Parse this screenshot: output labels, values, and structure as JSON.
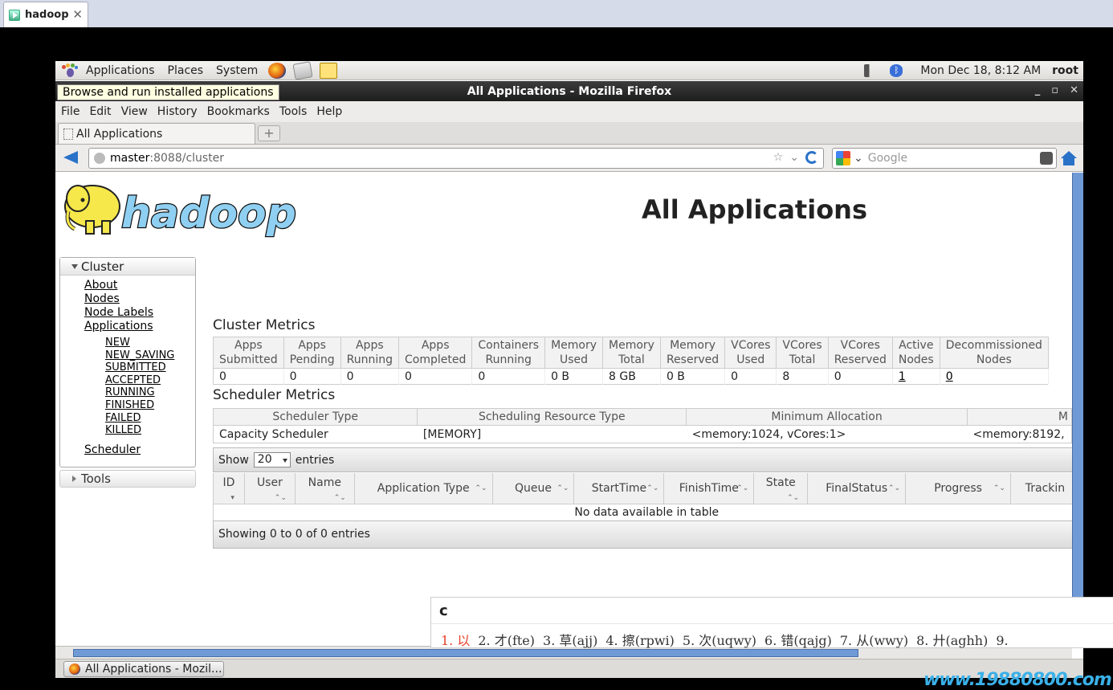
{
  "viewer": {
    "tab_title": "hadoop",
    "close_glyph": "✕"
  },
  "gnome_panel": {
    "menus": [
      "Applications",
      "Places",
      "System"
    ],
    "clock": "Mon Dec 18,  8:12 AM",
    "user": "root",
    "tooltip": "Browse and run installed applications"
  },
  "window": {
    "title": "All Applications - Mozilla Firefox",
    "controls": [
      "_",
      "▫",
      "✕"
    ]
  },
  "menubar": [
    "File",
    "Edit",
    "View",
    "History",
    "Bookmarks",
    "Tools",
    "Help"
  ],
  "tab": {
    "title": "All Applications",
    "new_tab_glyph": "+"
  },
  "navbar": {
    "url_host": "master",
    "url_path": ":8088/cluster",
    "search_placeholder": "Google"
  },
  "page": {
    "title": "All Applications",
    "sidebar": {
      "cluster_label": "Cluster",
      "links": [
        "About",
        "Nodes",
        "Node Labels",
        "Applications"
      ],
      "app_states": [
        "NEW",
        "NEW_SAVING",
        "SUBMITTED",
        "ACCEPTED",
        "RUNNING",
        "FINISHED",
        "FAILED",
        "KILLED"
      ],
      "scheduler_link": "Scheduler",
      "tools_label": "Tools"
    },
    "cluster_metrics": {
      "title": "Cluster Metrics",
      "headers": [
        [
          "Apps",
          "Submitted"
        ],
        [
          "Apps",
          "Pending"
        ],
        [
          "Apps",
          "Running"
        ],
        [
          "Apps",
          "Completed"
        ],
        [
          "Containers",
          "Running"
        ],
        [
          "Memory",
          "Used"
        ],
        [
          "Memory",
          "Total"
        ],
        [
          "Memory",
          "Reserved"
        ],
        [
          "VCores",
          "Used"
        ],
        [
          "VCores",
          "Total"
        ],
        [
          "VCores",
          "Reserved"
        ],
        [
          "Active",
          "Nodes"
        ],
        [
          "Decommissioned",
          "Nodes"
        ]
      ],
      "values": [
        "0",
        "0",
        "0",
        "0",
        "0",
        "0 B",
        "8 GB",
        "0 B",
        "0",
        "8",
        "0",
        "1",
        "0"
      ]
    },
    "scheduler_metrics": {
      "title": "Scheduler Metrics",
      "headers": [
        "Scheduler Type",
        "Scheduling Resource Type",
        "Minimum Allocation",
        "M"
      ],
      "values": [
        "Capacity Scheduler",
        "[MEMORY]",
        "<memory:1024, vCores:1>",
        "<memory:8192,"
      ]
    },
    "apps": {
      "show_label": "Show",
      "page_size": "20",
      "entries_label": "entries",
      "headers": [
        "ID",
        "User",
        "Name",
        "Application Type",
        "Queue",
        "StartTime",
        "FinishTime",
        "State",
        "FinalStatus",
        "Progress",
        "Trackin"
      ],
      "empty_text": "No data available in table",
      "footer": "Showing 0 to 0 of 0 entries"
    }
  },
  "ime": {
    "input": "c",
    "candidates": [
      "1. 以",
      "2. 才(fte)",
      "3. 草(ajj)",
      "4. 擦(rpwi)",
      "5. 次(uqwy)",
      "6. 错(qajg)",
      "7. 从(wwy)",
      "8. 廾(aghh)",
      "9."
    ]
  },
  "taskbar": {
    "item": "All Applications - Mozil..."
  },
  "watermark": "www.19880800.com"
}
